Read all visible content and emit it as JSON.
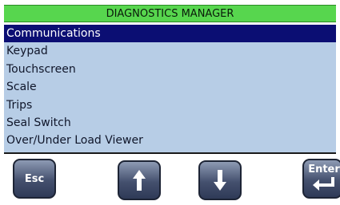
{
  "window": {
    "title": "DIAGNOSTICS MANAGER"
  },
  "menu": {
    "items": [
      {
        "label": "Communications",
        "selected": true
      },
      {
        "label": "Keypad",
        "selected": false
      },
      {
        "label": "Touchscreen",
        "selected": false
      },
      {
        "label": "Scale",
        "selected": false
      },
      {
        "label": "Trips",
        "selected": false
      },
      {
        "label": "Seal Switch",
        "selected": false
      },
      {
        "label": "Over/Under Load Viewer",
        "selected": false
      }
    ]
  },
  "buttons": {
    "esc_label": "Esc",
    "up_icon": "up-arrow-icon",
    "down_icon": "down-arrow-icon",
    "enter_label": "Enter",
    "enter_icon": "enter-return-icon"
  },
  "colors": {
    "title_bg": "#57d64e",
    "list_bg": "#b7cde6",
    "selected_bg": "#0b0e73",
    "selected_text": "#ffffff",
    "button_face": "#44506e"
  }
}
